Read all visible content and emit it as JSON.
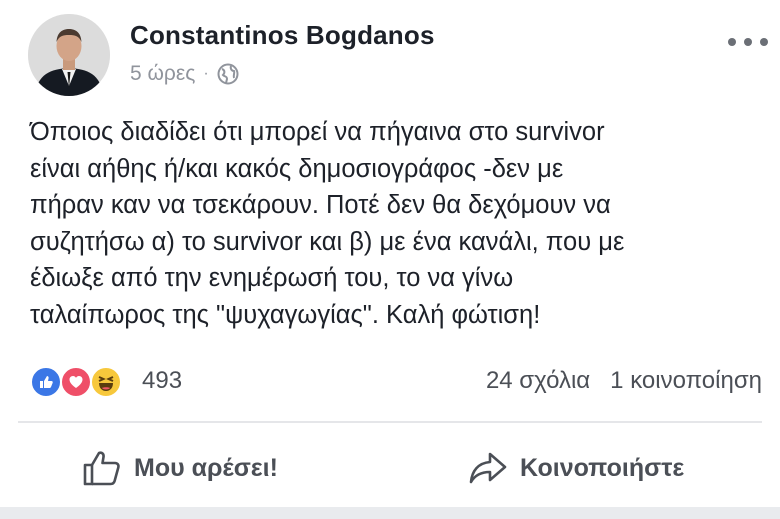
{
  "author": {
    "name": "Constantinos Bogdanos",
    "timestamp": "5 ώρες",
    "separator": "·",
    "audience_icon": "globe-icon"
  },
  "post": {
    "text_lines": [
      "Όποιος διαδίδει ότι μπορεί να πήγαινα στο survivor",
      "είναι αήθης ή/και κακός δημοσιογράφος -δεν με",
      "πήραν καν να τσεκάρουν. Ποτέ δεν θα δεχόμουν να",
      "συζητήσω α) το survivor και β) με ένα κανάλι, που με",
      "έδιωξε από την ενημέρωσή του, το να γίνω",
      "ταλαίπωρος της \"ψυχαγωγίας\". Καλή φώτιση!"
    ]
  },
  "reactions": {
    "icons": [
      "like-reaction-icon",
      "love-reaction-icon",
      "haha-reaction-icon"
    ],
    "count": "493",
    "comments": "24 σχόλια",
    "shares": "1 κοινοποίηση"
  },
  "actions": {
    "like_label": "Μου αρέσει!",
    "share_label": "Κοινοποιήστε"
  },
  "colors": {
    "like_blue": "#3b77e6",
    "love_red": "#ef4f68",
    "haha_yellow": "#f7c83c",
    "secondary_text": "#90949c"
  }
}
